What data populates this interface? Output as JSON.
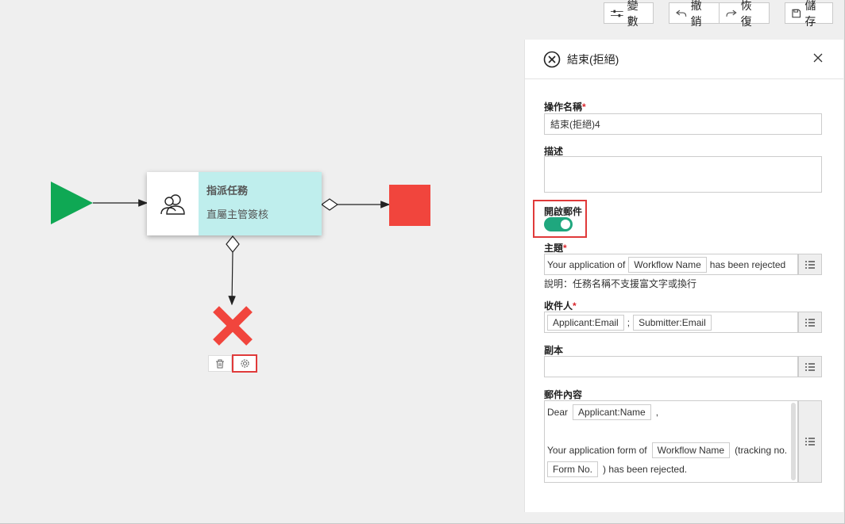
{
  "toolbar": {
    "variables_label": "變數",
    "undo_label": "撤銷",
    "redo_label": "恢復",
    "save_label": "儲存"
  },
  "canvas": {
    "task_title": "指派任務",
    "task_subtitle": "直屬主管簽核"
  },
  "panel": {
    "title": "結束(拒絕)",
    "operation_name": {
      "label": "操作名稱",
      "value": "結束(拒絕)4"
    },
    "description": {
      "label": "描述",
      "value": ""
    },
    "enable_mail": {
      "label": "開啟郵件",
      "on": true
    },
    "subject": {
      "label": "主題",
      "prefix": "Your application of",
      "tag": "Workflow Name",
      "suffix": "has been rejected",
      "hint": "說明：任務名稱不支援富文字或換行"
    },
    "recipients": {
      "label": "收件人",
      "tags": [
        "Applicant:Email",
        "Submitter:Email"
      ],
      "separator": ";"
    },
    "cc": {
      "label": "副本",
      "value": ""
    },
    "mail_body": {
      "label": "郵件內容",
      "greeting": "Dear",
      "greeting_tag": "Applicant:Name",
      "greeting_suffix": ",",
      "line2_prefix": "Your application form of",
      "line2_tag": "Workflow Name",
      "line2_suffix": "(tracking no.",
      "line3_tag": "Form No.",
      "line3_suffix": ") has been rejected."
    },
    "required_mark": "*"
  },
  "colors": {
    "start": "#0fa854",
    "end": "#f1453d",
    "reject": "#f1453d",
    "task_bg": "#bfeeed",
    "toggle_on": "#1fa77e",
    "highlight": "#e03a3a"
  }
}
